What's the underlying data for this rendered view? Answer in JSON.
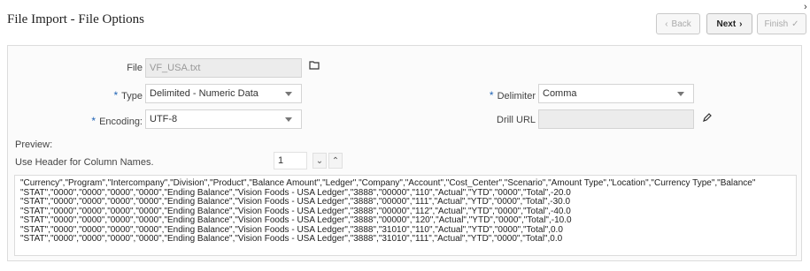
{
  "header": {
    "title": "File Import - File Options",
    "back_label": "Back",
    "next_label": "Next",
    "finish_label": "Finish"
  },
  "form": {
    "file_label": "File",
    "file_value": "VF_USA.txt",
    "type_label": "Type",
    "type_value": "Delimited - Numeric Data",
    "encoding_label": "Encoding:",
    "encoding_value": "UTF-8",
    "delimiter_label": "Delimiter",
    "delimiter_value": "Comma",
    "drill_url_label": "Drill URL",
    "drill_url_value": "",
    "required_mark": "*"
  },
  "preview": {
    "label": "Preview:",
    "header_label": "Use Header for Column Names.",
    "header_row": "1",
    "lines": [
      "\"Currency\",\"Program\",\"Intercompany\",\"Division\",\"Product\",\"Balance Amount\",\"Ledger\",\"Company\",\"Account\",\"Cost_Center\",\"Scenario\",\"Amount Type\",\"Location\",\"Currency Type\",\"Balance\"",
      "\"STAT\",\"0000\",\"0000\",\"0000\",\"0000\",\"Ending Balance\",\"Vision Foods - USA Ledger\",\"3888\",\"00000\",\"110\",\"Actual\",\"YTD\",\"0000\",\"Total\",-20.0",
      "\"STAT\",\"0000\",\"0000\",\"0000\",\"0000\",\"Ending Balance\",\"Vision Foods - USA Ledger\",\"3888\",\"00000\",\"111\",\"Actual\",\"YTD\",\"0000\",\"Total\",-30.0",
      "\"STAT\",\"0000\",\"0000\",\"0000\",\"0000\",\"Ending Balance\",\"Vision Foods - USA Ledger\",\"3888\",\"00000\",\"112\",\"Actual\",\"YTD\",\"0000\",\"Total\",-40.0",
      "\"STAT\",\"0000\",\"0000\",\"0000\",\"0000\",\"Ending Balance\",\"Vision Foods - USA Ledger\",\"3888\",\"00000\",\"120\",\"Actual\",\"YTD\",\"0000\",\"Total\",-10.0",
      "\"STAT\",\"0000\",\"0000\",\"0000\",\"0000\",\"Ending Balance\",\"Vision Foods - USA Ledger\",\"3888\",\"31010\",\"110\",\"Actual\",\"YTD\",\"0000\",\"Total\",0.0",
      "\"STAT\",\"0000\",\"0000\",\"0000\",\"0000\",\"Ending Balance\",\"Vision Foods - USA Ledger\",\"3888\",\"31010\",\"111\",\"Actual\",\"YTD\",\"0000\",\"Total\",0.0"
    ]
  }
}
